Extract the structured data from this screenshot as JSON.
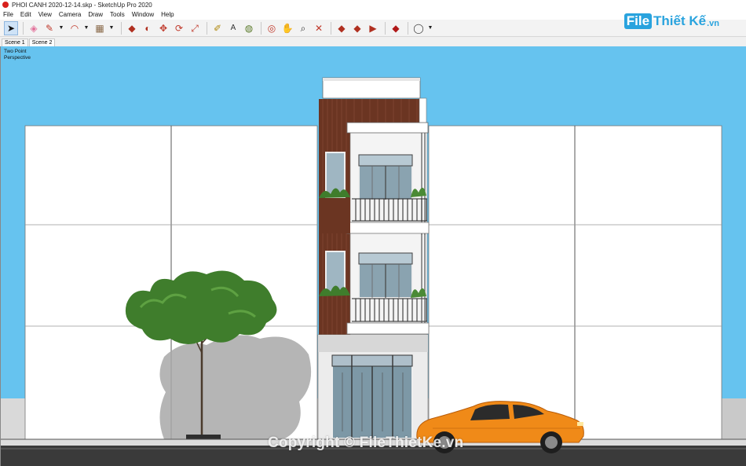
{
  "window": {
    "title": "PHOI CANH 2020-12-14.skp - SketchUp Pro 2020"
  },
  "menu": [
    "File",
    "Edit",
    "View",
    "Camera",
    "Draw",
    "Tools",
    "Window",
    "Help"
  ],
  "toolbar": {
    "tools": [
      {
        "name": "select",
        "glyph": "➤"
      },
      {
        "name": "eraser",
        "glyph": "◈"
      },
      {
        "name": "line",
        "glyph": "✎"
      },
      {
        "name": "arc",
        "glyph": "◠"
      },
      {
        "name": "rectangle",
        "glyph": "▦"
      },
      {
        "name": "push-pull",
        "glyph": "◆"
      },
      {
        "name": "follow-me",
        "glyph": "◐"
      },
      {
        "name": "move",
        "glyph": "✥"
      },
      {
        "name": "rotate",
        "glyph": "⟳"
      },
      {
        "name": "scale",
        "glyph": "⤢"
      },
      {
        "name": "tape-measure",
        "glyph": "✐"
      },
      {
        "name": "text",
        "glyph": "A"
      },
      {
        "name": "paint-bucket",
        "glyph": "◍"
      },
      {
        "name": "orbit",
        "glyph": "◎"
      },
      {
        "name": "pan",
        "glyph": "✋"
      },
      {
        "name": "zoom",
        "glyph": "⌕"
      },
      {
        "name": "zoom-extents",
        "glyph": "✕"
      },
      {
        "name": "3d-warehouse",
        "glyph": "◆"
      },
      {
        "name": "extension-warehouse",
        "glyph": "◆"
      },
      {
        "name": "send-to-layout",
        "glyph": "▶"
      },
      {
        "name": "ruby",
        "glyph": "◆"
      },
      {
        "name": "account",
        "glyph": "◯"
      }
    ]
  },
  "logo": {
    "box": "File",
    "text": "Thiết Kế",
    "suffix": ".vn"
  },
  "scenes": [
    "Scene 1",
    "Scene 2"
  ],
  "active_scene": "Scene 2",
  "view": {
    "label": "Two Point Perspective"
  },
  "watermark": "Copyright © FileThietKe.vn",
  "colors": {
    "sky": "#66c3ef",
    "wood": "#6b3522",
    "wall_white": "#ffffff",
    "car": "#f08a18",
    "tree": "#3f7d2c",
    "logo_blue": "#29a3de"
  }
}
